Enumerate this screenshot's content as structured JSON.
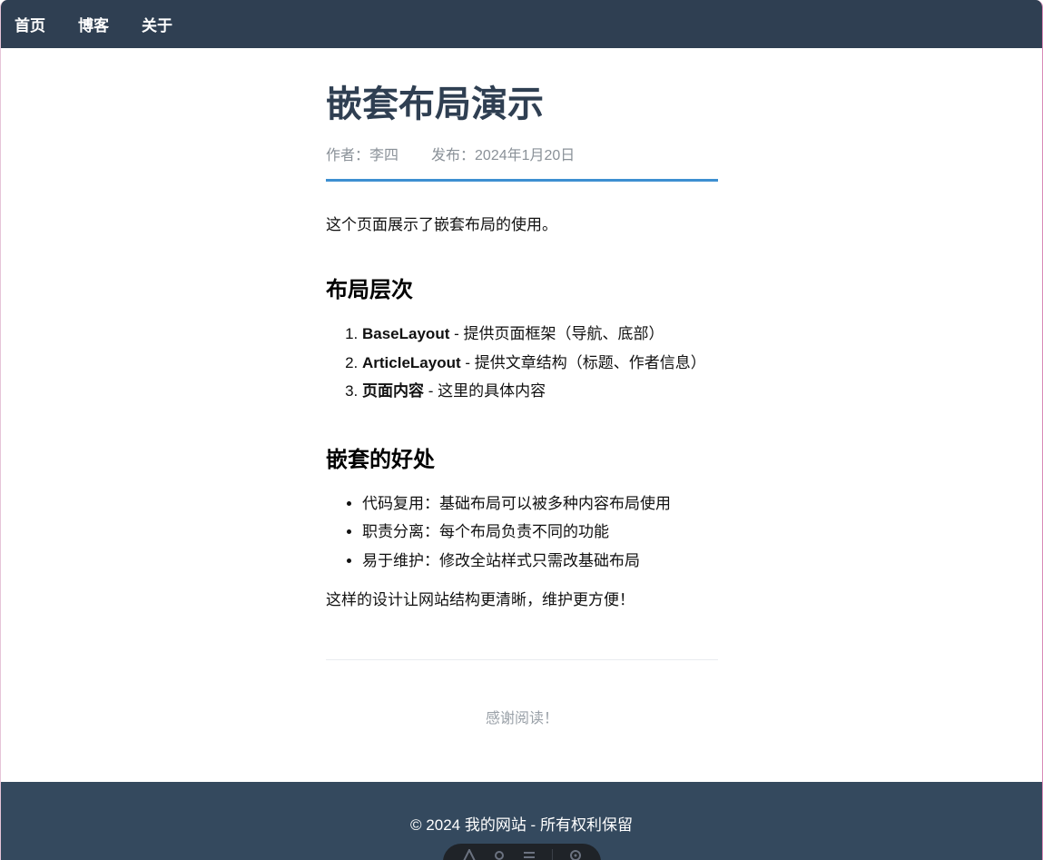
{
  "nav": {
    "items": [
      "首页",
      "博客",
      "关于"
    ]
  },
  "article": {
    "title": "嵌套布局演示",
    "author": "作者：李四",
    "published": "发布：2024年1月20日",
    "intro": "这个页面展示了嵌套布局的使用。",
    "section1": {
      "heading": "布局层次",
      "items": [
        {
          "bold": "BaseLayout",
          "text": " - 提供页面框架（导航、底部）"
        },
        {
          "bold": "ArticleLayout",
          "text": " - 提供文章结构（标题、作者信息）"
        },
        {
          "bold": "页面内容",
          "text": " - 这里的具体内容"
        }
      ]
    },
    "section2": {
      "heading": "嵌套的好处",
      "items": [
        "代码复用：基础布局可以被多种内容布局使用",
        "职责分离：每个布局负责不同的功能",
        "易于维护：修改全站样式只需改基础布局"
      ]
    },
    "closing": "这样的设计让网站结构更清晰，维护更方便！",
    "thanks": "感谢阅读！"
  },
  "footer": {
    "copyright": "© 2024 我的网站 - 所有权利保留"
  },
  "colors": {
    "nav_bg": "#2f3f52",
    "title": "#2f3f52",
    "accent_rule": "#3d8fd1",
    "footer_bg": "#34495e",
    "meta_text": "#8a9198"
  },
  "devbar": {
    "icons": [
      "devtools-logo-icon",
      "inspect-icon",
      "menu-icon",
      "settings-icon"
    ]
  }
}
